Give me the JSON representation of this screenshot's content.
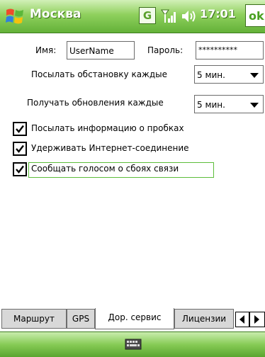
{
  "title_bar": {
    "title": "Москва",
    "g_icon": "G",
    "signal_icon": "signal-icon",
    "volume_icon": "volume-icon",
    "time": "17:01",
    "ok_label": "ok",
    "colors": {
      "bar": "#7cc34a",
      "text": "#ffffff"
    }
  },
  "form": {
    "username_label": "Имя:",
    "username_value": "UserName",
    "password_label": "Пароль:",
    "password_value": "**********",
    "send_label": "Посылать обстановку каждые",
    "send_value": "5 мин.",
    "recv_label": "Получать обновления каждые",
    "recv_value": "5 мин."
  },
  "options": [
    {
      "label": "Посылать информацию о пробках",
      "checked": true
    },
    {
      "label": "Удерживать Интернет-соединение",
      "checked": true
    },
    {
      "label": "Сообщать голосом о сбоях связи",
      "checked": true,
      "focused": true
    }
  ],
  "tabs": {
    "items": [
      "Маршрут",
      "GPS",
      "Дор. сервис",
      "Лицензии"
    ],
    "active": "Дор. сервис"
  },
  "bottom_bar": {
    "icon": "keyboard-icon"
  }
}
